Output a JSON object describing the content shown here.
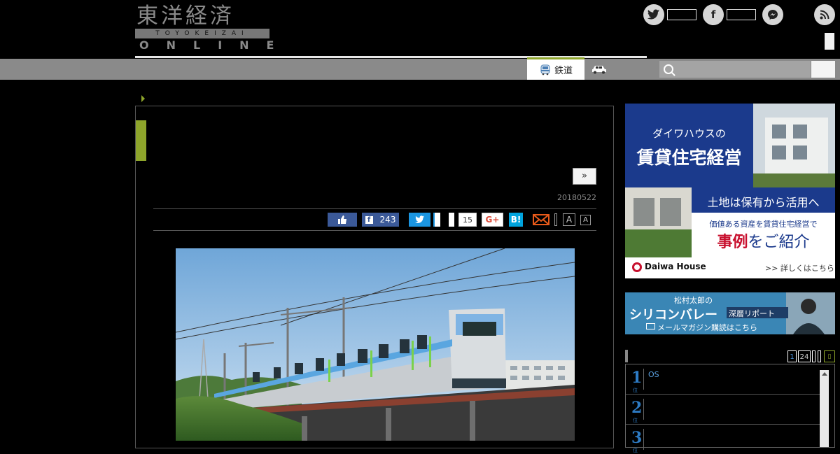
{
  "logo": {
    "kanji": "東洋経済",
    "band": "TOYOKEIZAI",
    "online": "ONLINE"
  },
  "social_top": [
    "twitter-icon",
    "facebook-icon",
    "messenger-icon",
    "rss-icon"
  ],
  "nav": {
    "tabs": [
      {
        "label": "鉄道",
        "icon": "train-icon",
        "active": true
      },
      {
        "label": "",
        "icon": "car-icon",
        "active": false
      }
    ],
    "search": {
      "placeholder": "",
      "button_label": ""
    }
  },
  "article": {
    "next_label": "»",
    "date": "20180522",
    "share": {
      "facebook_count": "243",
      "hatena_count": "15",
      "gplus_label": "G+",
      "hatena_label": "B!"
    },
    "font_buttons": [
      "A",
      "A"
    ]
  },
  "sidebar": {
    "ad1": {
      "headline1": "ダイワハウスの",
      "headline2": "賃貸住宅経営",
      "sub1": "土地は保有から活用へ",
      "sub2": "価値ある資産を賃貸住宅経営で",
      "sub3_a": "事例",
      "sub3_b": "をご紹介",
      "brand": "Daiwa House",
      "link": ">> 詳しくはこちら"
    },
    "ad2": {
      "line1": "松村太郎の",
      "line2a": "シリコンバレー",
      "line2b": "深層リポート",
      "line3": "メールマガジン購読はこちら"
    },
    "ranking": {
      "page_buttons": [
        "1",
        "24"
      ],
      "items": [
        {
          "rank": "1",
          "suffix": "位",
          "title": "OS"
        },
        {
          "rank": "2",
          "suffix": "位",
          "title": ""
        },
        {
          "rank": "3",
          "suffix": "位",
          "title": ""
        }
      ]
    }
  },
  "colors": {
    "accent_green": "#8ea52b",
    "nav_gray": "#8a8a8a",
    "twitter": "#1b95e0",
    "facebook": "#3b5998",
    "hatena": "#00a4de",
    "rank_blue": "#2d7bc4"
  }
}
